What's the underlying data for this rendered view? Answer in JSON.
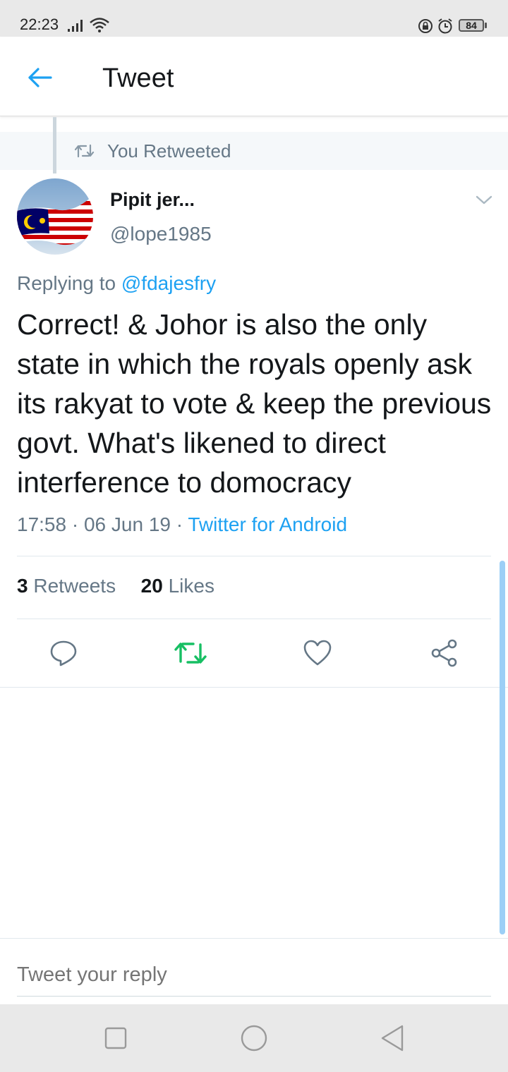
{
  "status_bar": {
    "time": "22:23",
    "battery": "84"
  },
  "header": {
    "title": "Tweet"
  },
  "retweet_context": {
    "label": "You Retweeted"
  },
  "tweet": {
    "author_name": "Pipit jer...",
    "author_handle": "@lope1985",
    "replying_prefix": "Replying to",
    "replying_to": "@fdajesfry",
    "text": "Correct! & Johor is also the only state in which the royals openly ask its rakyat to vote & keep the previous govt. What's likened to direct interference to domocracy",
    "time": "17:58",
    "date": "06 Jun 19",
    "source": "Twitter for Android",
    "retweets_count": "3",
    "retweets_label": "Retweets",
    "likes_count": "20",
    "likes_label": "Likes"
  },
  "reply": {
    "placeholder": "Tweet your reply"
  },
  "colors": {
    "accent": "#1da1f2",
    "retweet_active": "#17bf63",
    "secondary_text": "#657786"
  }
}
